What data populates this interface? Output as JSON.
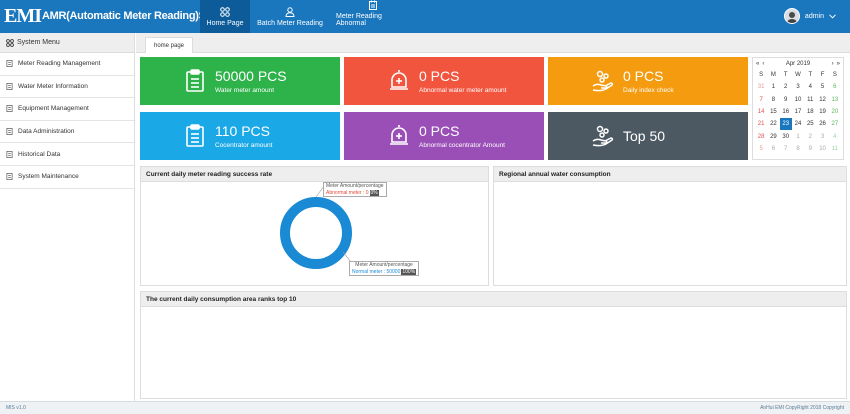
{
  "app": {
    "logo": "EMI",
    "title": "AMR(Automatic Meter Reading)System"
  },
  "nav": [
    {
      "label": "Home Page",
      "icon": "grid-icon"
    },
    {
      "label": "Batch Meter Reading",
      "icon": "user-icon"
    },
    {
      "label": "Meter Reading Abnormal",
      "icon": "clipboard-icon"
    }
  ],
  "user": {
    "name": "admin"
  },
  "sidebar": {
    "title": "System Menu",
    "items": [
      {
        "label": "Meter Reading Management"
      },
      {
        "label": "Water Meter Information"
      },
      {
        "label": "Equipment Management"
      },
      {
        "label": "Data Administration"
      },
      {
        "label": "Historical Data"
      },
      {
        "label": "System Maintenance"
      }
    ]
  },
  "tabs": [
    {
      "label": "home page"
    }
  ],
  "cards": [
    {
      "value": "50000 PCS",
      "label": "Water meter amount",
      "color": "#2eb24a",
      "icon": "clipboard-icon"
    },
    {
      "value": "0 PCS",
      "label": "Abnormal water meter amount",
      "color": "#f2553e",
      "icon": "alarm-bell-icon"
    },
    {
      "value": "0 PCS",
      "label": "Daily index check",
      "color": "#f49b0f",
      "icon": "hand-coins-icon"
    },
    {
      "value": "110 PCS",
      "label": "Cocentrator amount",
      "color": "#1ba8e6",
      "icon": "clipboard-icon"
    },
    {
      "value": "0 PCS",
      "label": "Abnormal cocentrator Amount",
      "color": "#9a4fb7",
      "icon": "alarm-bell-icon"
    },
    {
      "value": "Top 50",
      "label": "",
      "color": "#4c5963",
      "icon": "hand-coins-icon"
    }
  ],
  "calendar": {
    "month": "Apr 2019",
    "nav": {
      "prev_year": "«",
      "prev": "‹",
      "next": "›",
      "next_year": "»"
    },
    "weekdays": [
      "S",
      "M",
      "T",
      "W",
      "T",
      "F",
      "S"
    ],
    "weeks": [
      [
        "31",
        "1",
        "2",
        "3",
        "4",
        "5",
        "6"
      ],
      [
        "7",
        "8",
        "9",
        "10",
        "11",
        "12",
        "13"
      ],
      [
        "14",
        "15",
        "16",
        "17",
        "18",
        "19",
        "20"
      ],
      [
        "21",
        "22",
        "23",
        "24",
        "25",
        "26",
        "27"
      ],
      [
        "28",
        "29",
        "30",
        "1",
        "2",
        "3",
        "4"
      ],
      [
        "5",
        "6",
        "7",
        "8",
        "9",
        "10",
        "11"
      ]
    ],
    "today": "23"
  },
  "panels": {
    "success_rate": {
      "title": "Current daily meter reading success rate",
      "tooltip_abnormal": {
        "header": "Meter Amount/percentage",
        "text": "Abnormal meter : 0",
        "badge": "0%"
      },
      "tooltip_normal": {
        "header": "Meter Amount/percentage",
        "text": "Normal meter : 50000",
        "badge": "100%"
      }
    },
    "regional": {
      "title": "Regional annual water consumption"
    },
    "top10": {
      "title": "The current daily consumption area ranks top 10"
    }
  },
  "chart_data": {
    "type": "pie",
    "categories": [
      "Abnormal meter",
      "Normal meter"
    ],
    "values": [
      0,
      50000
    ],
    "percentages": [
      "0%",
      "100%"
    ],
    "colors": [
      "#e64a3b",
      "#1a8ad4"
    ]
  },
  "footer": {
    "left": "MIS v1.0",
    "right": "AnHui EMI CopyRight 2018  Copyright"
  }
}
